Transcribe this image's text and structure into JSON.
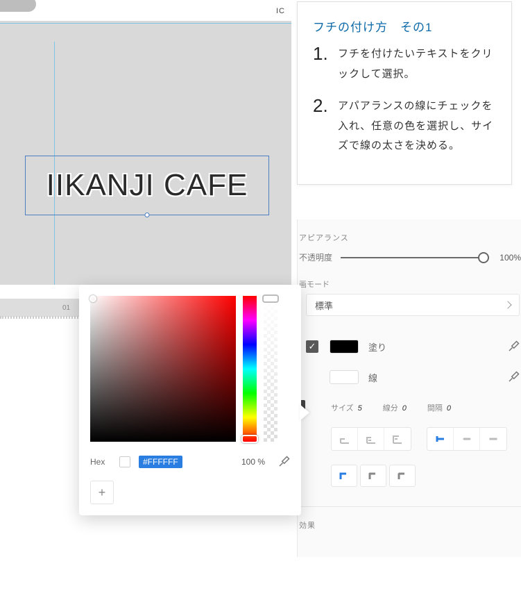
{
  "canvas": {
    "top_label": "IC",
    "text_content": "IIKANJI CAFE",
    "timeline_marker": "01"
  },
  "callout": {
    "title": "フチの付け方　その1",
    "steps": [
      {
        "num": "1.",
        "text": "フチを付けたいテキストをクリックして選択。"
      },
      {
        "num": "2.",
        "text": "アパアランスの線にチェックを入れ、任意の色を選択し、サイズで線の太さを決める。"
      }
    ]
  },
  "panel": {
    "appearance_title": "アピアランス",
    "opacity_label": "不透明度",
    "opacity_value": "100%",
    "blend_label": "画モード",
    "blend_value": "標準",
    "fill_label": "塗り",
    "stroke_label": "線",
    "size_label": "サイズ",
    "size_value": "5",
    "dash_label": "線分",
    "dash_value": "0",
    "gap_label": "間隔",
    "gap_value": "0",
    "effects_title": "効果"
  },
  "picker": {
    "hex_label": "Hex",
    "hex_value": "#FFFFFF",
    "alpha_value": "100 %",
    "add_label": "+"
  }
}
